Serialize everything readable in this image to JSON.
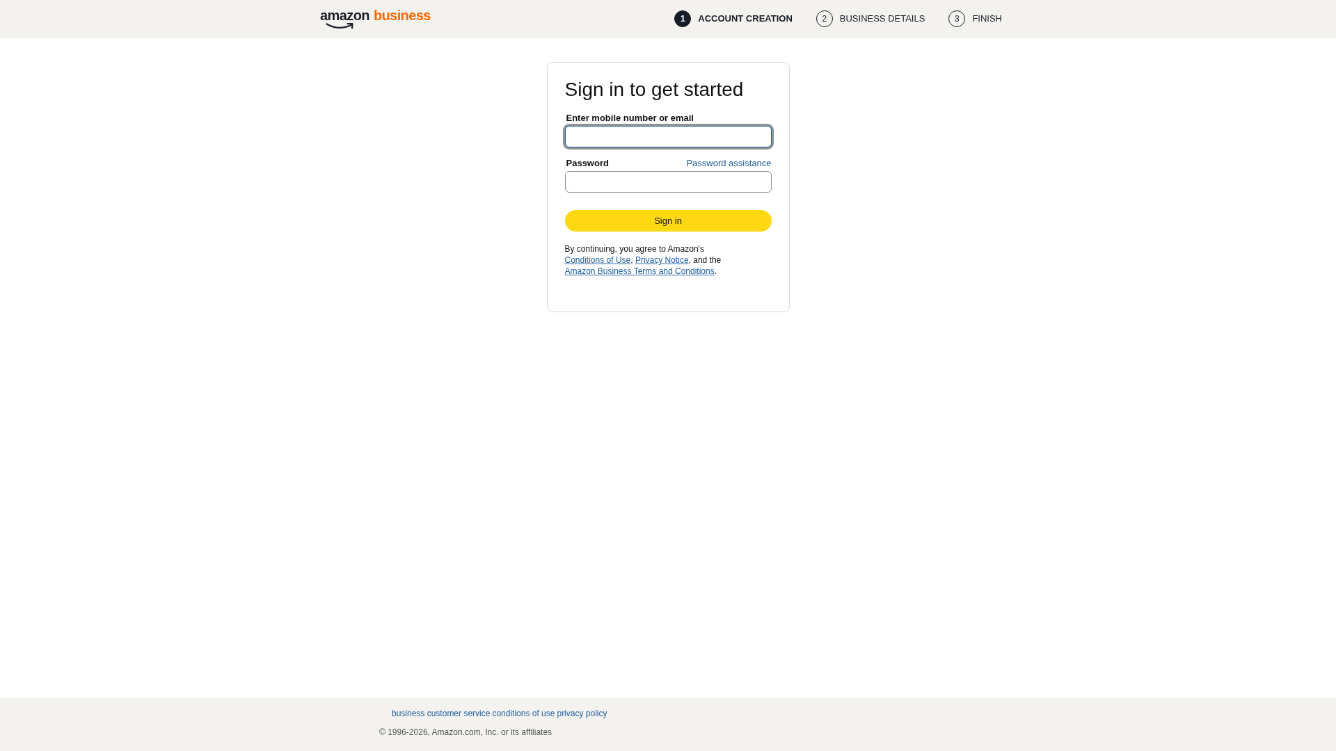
{
  "header": {
    "logo": {
      "wordmark": "amazon",
      "product": "business"
    },
    "steps": [
      {
        "number": "1",
        "label": "ACCOUNT CREATION",
        "current": true
      },
      {
        "number": "2",
        "label": "BUSINESS DETAILS",
        "current": false
      },
      {
        "number": "3",
        "label": "FINISH",
        "current": false
      }
    ]
  },
  "signin_card": {
    "title": "Sign in to get started",
    "fields": [
      {
        "label": "Enter mobile number or email",
        "focused": true
      },
      {
        "label": "Password",
        "link": "Password assistance",
        "focused": false
      }
    ],
    "button": "Sign in",
    "legal": [
      {
        "kind": "text",
        "text": "By continuing, you agree to Amazon's "
      },
      {
        "kind": "link",
        "text": "Conditions of Use"
      },
      {
        "kind": "text",
        "text": ", "
      },
      {
        "kind": "link",
        "text": "Privacy Notice"
      },
      {
        "kind": "text",
        "text": ", and the "
      },
      {
        "kind": "link",
        "text": "Amazon Business Terms and Conditions"
      },
      {
        "kind": "text",
        "text": "."
      }
    ]
  },
  "footer": {
    "links": [
      "business customer service",
      "conditions of use",
      "privacy policy"
    ],
    "copyright": "© 1996-2026, Amazon.com, Inc. or its affiliates"
  }
}
